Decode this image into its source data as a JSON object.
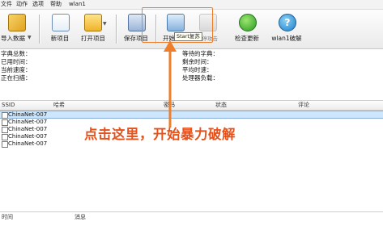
{
  "menu": [
    "文件",
    "动作",
    "选项",
    "帮助",
    "wlan1"
  ],
  "toolbar": {
    "import": "导入数据",
    "new": "新项目",
    "open": "打开项目",
    "save": "保存项目",
    "start": "开始攻击",
    "pause": "暂停攻击",
    "update": "检查更新",
    "wlan": "wlan1破解",
    "dropdown_arrow": "▼",
    "tooltip": "Start复苏"
  },
  "stats_left": [
    "字典总数：",
    "已用时间：",
    "当前速度：",
    "正在扫描："
  ],
  "stats_right": [
    "等待的字典：",
    "剩余时间：",
    "平均时速：",
    "处理器负载："
  ],
  "table": {
    "columns": [
      "SSID",
      "哈希",
      "密码",
      "状态",
      "评论"
    ],
    "rows": [
      "ChinaNet-007",
      "ChinaNet-007",
      "ChinaNet-007",
      "ChinaNet-007",
      "ChinaNet-007"
    ],
    "selected_index": 0
  },
  "annotation": {
    "text": "点击这里，开始暴力破解",
    "color": "#e8501a"
  },
  "log": {
    "columns": [
      "时间",
      "消息"
    ]
  }
}
